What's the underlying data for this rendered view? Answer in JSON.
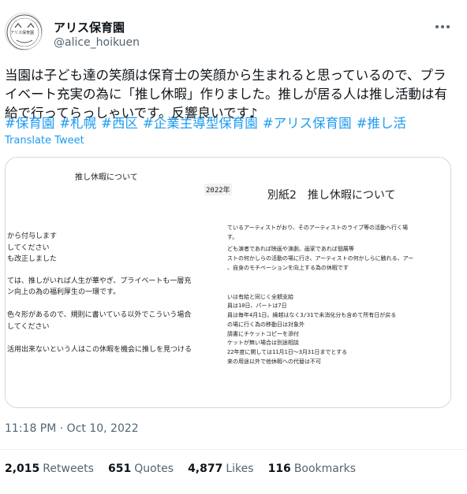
{
  "author": {
    "name": "アリス保育園",
    "handle": "@alice_hoikuen",
    "avatar_text": "アリス保育園"
  },
  "tweet": {
    "text": "当園は子ども達の笑顔は保育士の笑顔から生まれると思っているので、プライベート充実の為に「推し休暇」作りました。推しが居る人は推し活動は有給で行ってらっしゃいです。反響良いです♪",
    "hashtags": [
      "#保育園",
      "#札幌",
      "#西区",
      "#企業主導型保育園",
      "#アリス保育園",
      "#推し活"
    ],
    "translate_label": "Translate Tweet",
    "timestamp": "11:18 PM · Oct 10, 2022"
  },
  "image": {
    "left_title": "推し休暇について",
    "year": "2022年",
    "right_title": "別紙2　推し休暇について",
    "left_lines": [
      "から付与します",
      "してください",
      "も改正しました",
      "ては、推しがいれば人生が華やぎ、プライベートも一層充",
      "ン向上の為の福利厚生の一環です。",
      "色々形があるので、規則に書いている以外でこういう場合",
      "してください",
      "活用出来ないという人はこの休暇を機会に推しを見つける"
    ],
    "right_lines": [
      "ているアーティストがおり、そのアーティストのライブ等の活動へ行く場",
      "す。",
      "ども演者であれば映画や演劇、画家であれば個展等",
      "ストの何かしらの活動の場に行き、アーティストの何かしらに触れる、アー",
      "、自身のモチベーションを向上する為の休暇です",
      "いは有給と同じく全額支給",
      "員は10日、パートは7日",
      "員は毎年4月1日。繰越はなく3/31で未消化分も含めて所有日が戻る",
      "の場に行く為の移動日は対象外",
      "請書にチケットコピーを添付",
      "ケットが無い場合は別途相談",
      "22年度に関しては11月1日～3月31日までとする",
      "来の用途以外で他休暇への代替は不可"
    ]
  },
  "stats": [
    {
      "count": "2,015",
      "label": "Retweets"
    },
    {
      "count": "651",
      "label": "Quotes"
    },
    {
      "count": "4,877",
      "label": "Likes"
    },
    {
      "count": "116",
      "label": "Bookmarks"
    }
  ]
}
